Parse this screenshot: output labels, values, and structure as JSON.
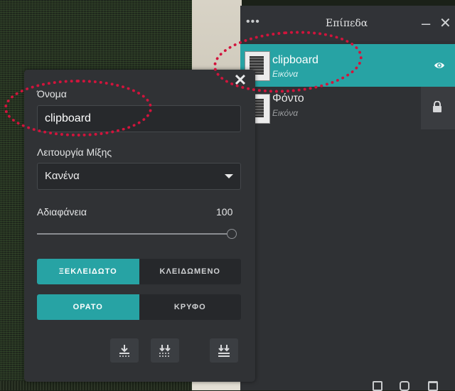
{
  "layers_panel": {
    "title": "Επίπεδα",
    "more_icon": "more-dots-icon",
    "minimize_label": "–",
    "close_label": "✕",
    "layers": [
      {
        "name": "clipboard",
        "type": "Εικόνα",
        "selected": true,
        "status_icon": "eye-icon"
      },
      {
        "name": "Φόντο",
        "type": "Εικόνα",
        "selected": false,
        "status_icon": "lock-icon"
      }
    ],
    "footer_icons": [
      "add-layer-icon",
      "duplicate-layer-icon",
      "delete-layer-icon"
    ]
  },
  "properties": {
    "close_label": "✕",
    "name_label": "Όνομα",
    "name_value": "clipboard",
    "blend_label": "Λειτουργία Μίξης",
    "blend_value": "Κανένα",
    "opacity_label": "Αδιαφάνεια",
    "opacity_value": "100",
    "opacity_fraction": 1.0,
    "lock_options": {
      "unlocked": "ΞΕΚΛΕΙΔΩΤΟ",
      "locked": "ΚΛΕΙΔΩΜΕΝΟ",
      "selected": "unlocked"
    },
    "visibility_options": {
      "visible": "ΟΡΑΤΟ",
      "hidden": "ΚΡΥΦΟ",
      "selected": "visible"
    },
    "merge_buttons": [
      "merge-down-icon",
      "merge-visible-icon",
      "merge-all-icon"
    ]
  },
  "colors": {
    "accent": "#27a3a4",
    "annotation": "#d1143c",
    "panel": "#303235"
  }
}
